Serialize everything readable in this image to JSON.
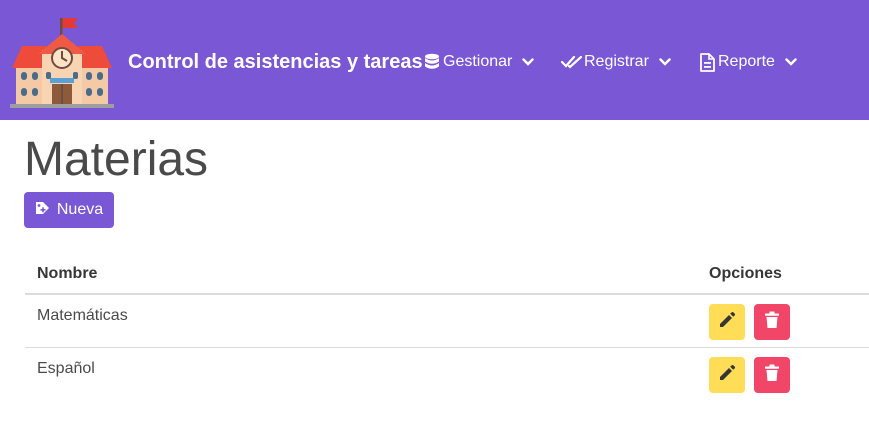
{
  "navbar": {
    "brand_title": "Control de asistencias y tareas",
    "brand_icon": "school-icon",
    "menu": [
      {
        "label": "Gestionar",
        "icon": "database-icon"
      },
      {
        "label": "Registrar",
        "icon": "double-check-icon"
      },
      {
        "label": "Reporte",
        "icon": "file-report-icon"
      }
    ]
  },
  "page": {
    "title": "Materias",
    "new_button_label": "Nueva"
  },
  "table": {
    "headers": [
      "Nombre",
      "Opciones"
    ],
    "rows": [
      {
        "name": "Matemáticas"
      },
      {
        "name": "Español"
      }
    ]
  },
  "colors": {
    "primary": "#7957d5",
    "edit": "#ffdd57",
    "delete": "#f14668",
    "text": "#4a4a4a"
  }
}
